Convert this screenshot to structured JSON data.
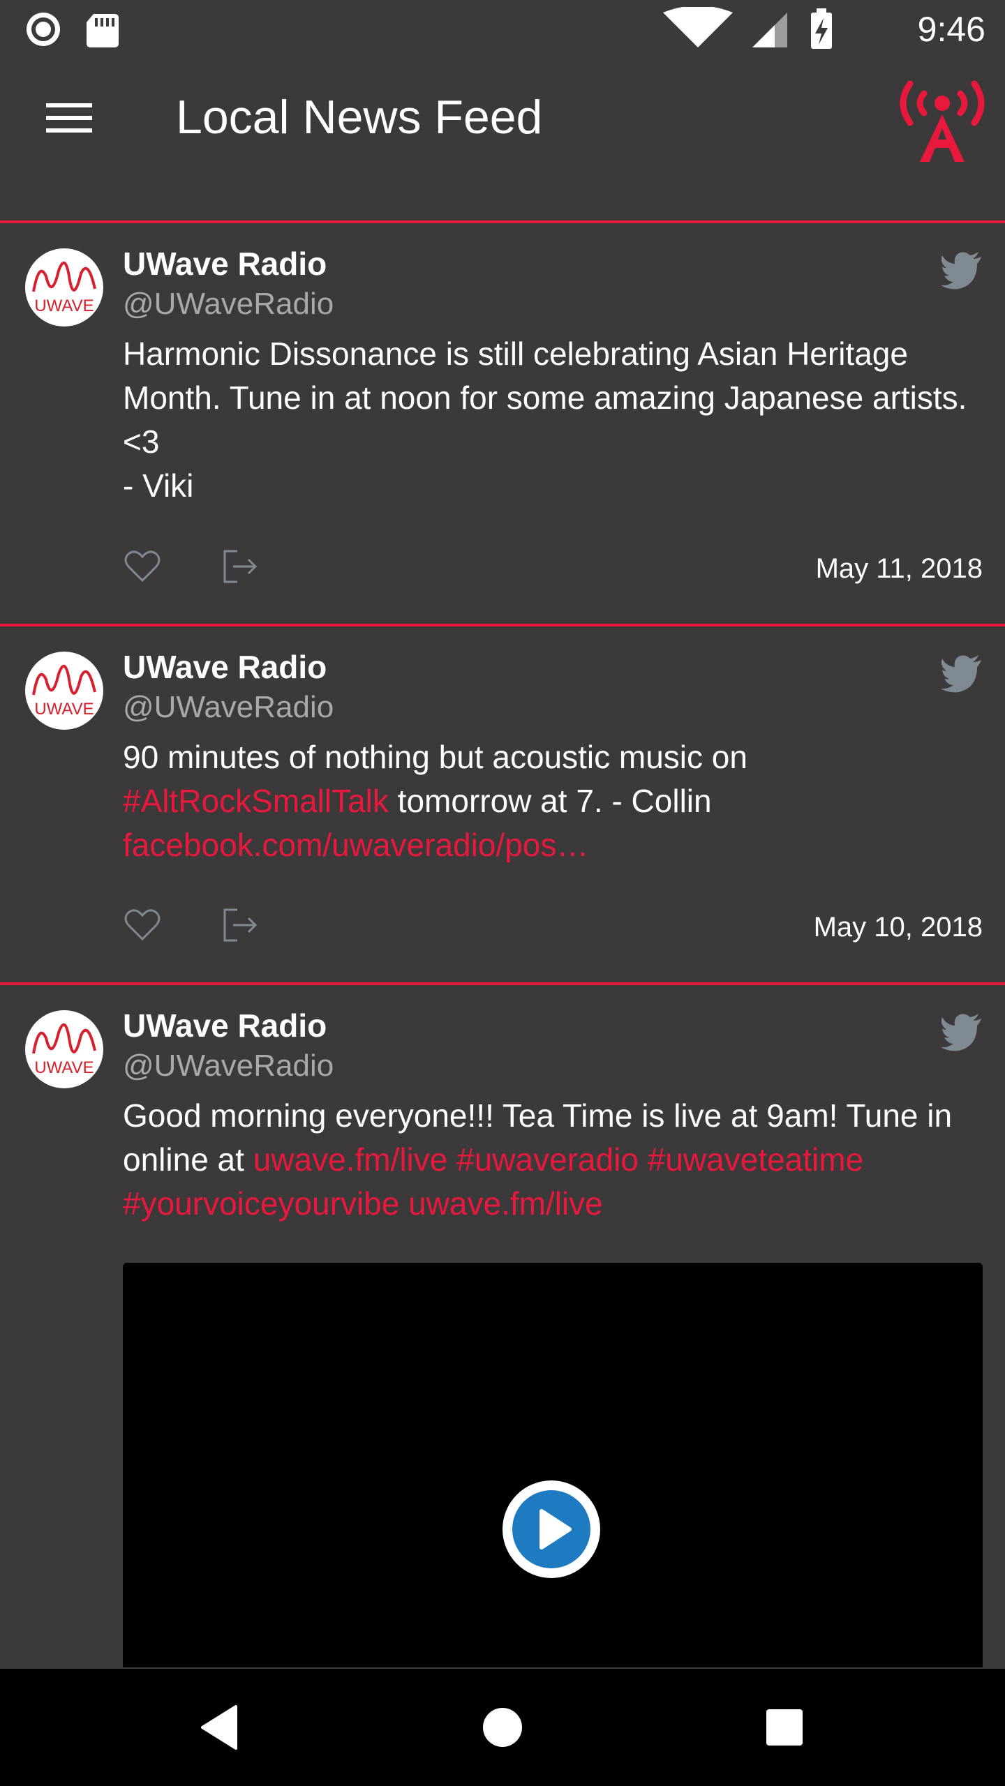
{
  "status_bar": {
    "time": "9:46",
    "icons": [
      "record-icon",
      "sd-card-icon",
      "wifi-icon",
      "signal-icon",
      "battery-charging-icon"
    ]
  },
  "app_bar": {
    "title": "Local News Feed",
    "menu_icon": "hamburger-menu-icon",
    "logo_icon": "radio-tower-icon"
  },
  "colors": {
    "background": "#3c393a",
    "accent": "#e8193c",
    "handle": "#a9a9a9",
    "icon_muted": "#7f8a93",
    "play": "#1f7bc1"
  },
  "posts": [
    {
      "author": "UWave Radio",
      "handle": "@UWaveRadio",
      "avatar_text": "UWAVE",
      "text_parts": [
        {
          "t": "Harmonic Dissonance is still celebrating Asian Heritage Month. Tune in at noon for some amazing Japanese artists. <3",
          "link": false
        },
        {
          "t": "\n- Viki",
          "link": false
        }
      ],
      "date": "May 11, 2018"
    },
    {
      "author": "UWave Radio",
      "handle": "@UWaveRadio",
      "avatar_text": "UWAVE",
      "text_parts": [
        {
          "t": "90 minutes of nothing but acoustic music on ",
          "link": false
        },
        {
          "t": "#AltRockSmallTalk",
          "link": true
        },
        {
          "t": " tomorrow at 7. - Collin ",
          "link": false
        },
        {
          "t": "facebook.com/uwaveradio/pos…",
          "link": true
        }
      ],
      "date": "May 10, 2018"
    },
    {
      "author": "UWave Radio",
      "handle": "@UWaveRadio",
      "avatar_text": "UWAVE",
      "text_parts": [
        {
          "t": "Good morning everyone!!! Tea Time is live at 9am! Tune in online at ",
          "link": false
        },
        {
          "t": "uwave.fm/live",
          "link": true
        },
        {
          "t": " ",
          "link": false
        },
        {
          "t": "#uwaveradio",
          "link": true
        },
        {
          "t": " ",
          "link": false
        },
        {
          "t": "#uwaveteatime",
          "link": true
        },
        {
          "t": " ",
          "link": false
        },
        {
          "t": "#yourvoiceyourvibe",
          "link": true
        },
        {
          "t": " ",
          "link": false
        },
        {
          "t": "uwave.fm/live",
          "link": true
        }
      ],
      "has_video": true
    }
  ],
  "nav_bar": {
    "buttons": [
      "back-icon",
      "home-icon",
      "recents-icon"
    ]
  }
}
